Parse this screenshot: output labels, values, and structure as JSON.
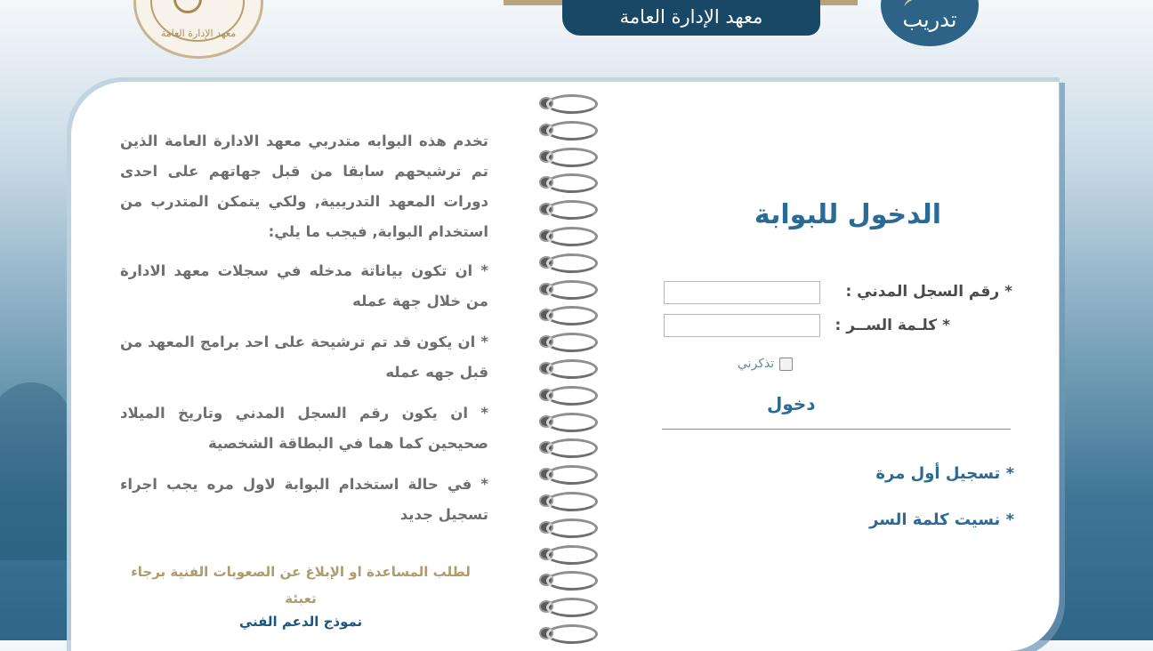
{
  "header": {
    "institute_banner": "معهد الإدارة العامة",
    "brand_text": "تدريب",
    "seal_text": "معهد الإدارة العامة"
  },
  "intro": {
    "paragraph": "تخدم هذه البوابه متدربي معهد الادارة العامة الذين تم ترشيحهم سابقا من قبل جهاتهم على احدى دورات المعهد التدريبية, ولكي يتمكن المتدرب من استخدام البوابة, فيجب ما يلي:",
    "bullets": [
      "* ان تكون بياناتة مدخله في سجلات معهد الادارة من خلال جهة عمله",
      "* ان يكون قد تم ترشيحة على احد برامج المعهد من قبل جهه عمله",
      "* ان يكون رقم السجل المدني وتاريخ الميلاد صحيحين كما هما في البطاقة الشخصية",
      "* في حالة استخدام البوابة لاول مره يجب اجراء تسجيل جديد"
    ],
    "help_text": "لطلب المساعدة او الإبلاغ عن الصعوبات الفنية برجاء تعبئة",
    "help_link": "نموذج الدعم الفني"
  },
  "login": {
    "title": "الدخول للبوابة",
    "civil_id_label": "* رقم السجل المدني :",
    "civil_id_value": "",
    "password_label": "* كلـمة الســر :",
    "password_value": "",
    "remember_label": "تذكرني",
    "remember_checked": false,
    "submit_label": "دخول",
    "first_time_link": "* تسجيل أول مرة",
    "forgot_password_link": "* نسيت كلمة السر"
  },
  "colors": {
    "primary": "#2b6a95",
    "banner": "#184866",
    "gold": "#b19b6d",
    "text": "#6e6e6e"
  }
}
